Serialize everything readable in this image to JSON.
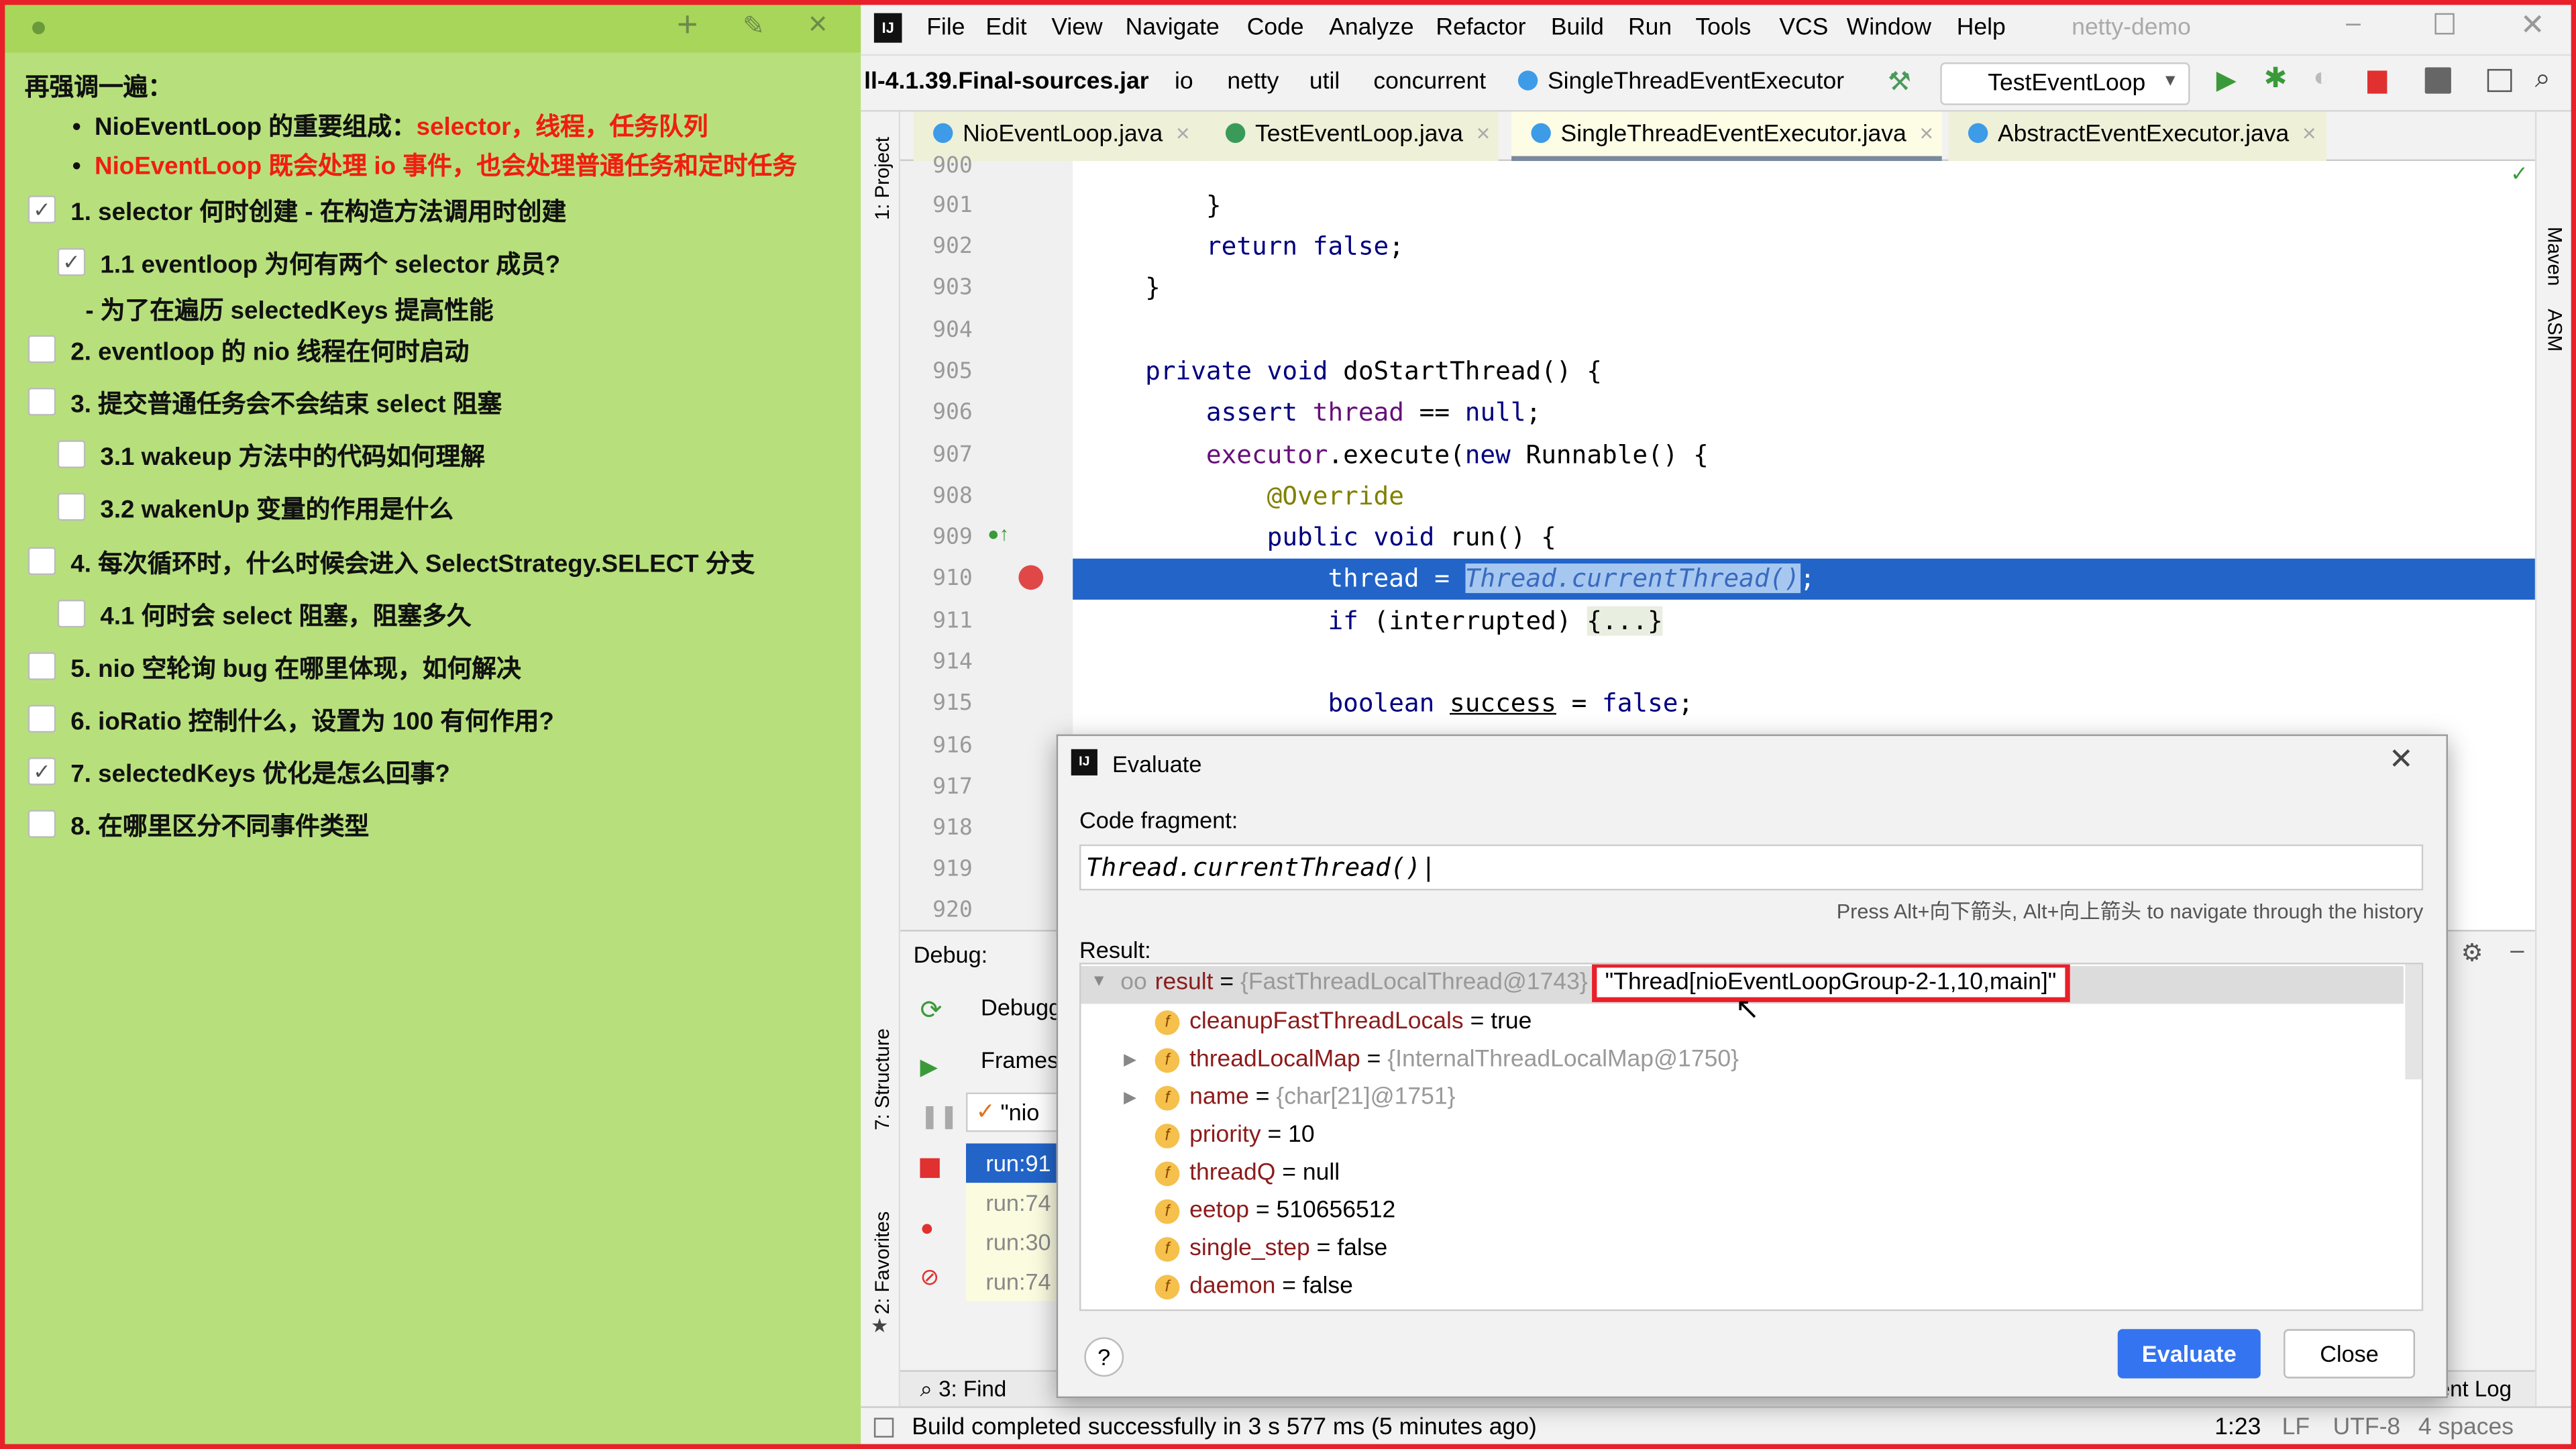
{
  "note": {
    "heading": "再强调一遍：",
    "bullets": [
      {
        "black": "NioEventLoop 的重要组成：",
        "red": "selector，线程，任务队列"
      },
      {
        "black": "",
        "red": "NioEventLoop 既会处理 io 事件，也会处理普通任务和定时任务"
      }
    ],
    "items": [
      {
        "text": "1. selector 何时创建 - 在构造方法调用时创建",
        "checked": true
      },
      {
        "text": "1.1 eventloop 为何有两个 selector 成员?",
        "checked": true
      },
      {
        "text": "- 为了在遍历 selectedKeys 提高性能",
        "checked": null
      },
      {
        "text": "2. eventloop 的 nio 线程在何时启动",
        "checked": false
      },
      {
        "text": "3. 提交普通任务会不会结束 select 阻塞",
        "checked": false
      },
      {
        "text": "3.1 wakeup 方法中的代码如何理解",
        "checked": false
      },
      {
        "text": "3.2 wakenUp 变量的作用是什么",
        "checked": false
      },
      {
        "text": "4. 每次循环时，什么时候会进入 SelectStrategy.SELECT 分支",
        "checked": false
      },
      {
        "text": "4.1 何时会 select 阻塞，阻塞多久",
        "checked": false
      },
      {
        "text": "5. nio 空轮询 bug 在哪里体现，如何解决",
        "checked": false
      },
      {
        "text": "6. ioRatio 控制什么，设置为 100 有何作用?",
        "checked": false
      },
      {
        "text": "7. selectedKeys 优化是怎么回事?",
        "checked": true
      },
      {
        "text": "8. 在哪里区分不同事件类型",
        "checked": false
      }
    ],
    "header_buttons": [
      "+",
      "pin",
      "×"
    ]
  },
  "ide": {
    "menu": [
      "File",
      "Edit",
      "View",
      "Navigate",
      "Code",
      "Analyze",
      "Refactor",
      "Build",
      "Run",
      "Tools",
      "VCS",
      "Window",
      "Help"
    ],
    "project_title": "netty-demo",
    "breadcrumb": [
      "ll-4.1.39.Final-sources.jar",
      "io",
      "netty",
      "util",
      "concurrent",
      "SingleThreadEventExecutor"
    ],
    "run_config": "TestEventLoop",
    "tabs": [
      {
        "label": "NioEventLoop.java",
        "active": false
      },
      {
        "label": "TestEventLoop.java",
        "active": false
      },
      {
        "label": "SingleThreadEventExecutor.java",
        "active": true
      },
      {
        "label": "AbstractEventExecutor.java",
        "active": false
      }
    ],
    "left_tools": [
      "1: Project",
      "7: Structure",
      "2: Favorites"
    ],
    "right_tools": [
      "Maven",
      "ASM"
    ],
    "line_numbers": [
      "900",
      "901",
      "902",
      "903",
      "904",
      "905",
      "906",
      "907",
      "908",
      "909",
      "910",
      "911",
      "914",
      "915",
      "916",
      "917",
      "918",
      "919",
      "920"
    ],
    "code": {
      "l901": "        }",
      "l902_kw": "return false",
      "l903": "    }",
      "l905_kw": "private void ",
      "l905_rest": "doStartThread() {",
      "l906_kw": "assert ",
      "l906_f": "thread",
      "l906_rest": " == ",
      "l906_kw2": "null",
      "l907_f": "executor",
      "l907_rest": ".execute(",
      "l907_kw": "new ",
      "l907_rest2": "Runnable() {",
      "l908": "@Override",
      "l909_kw": "public void ",
      "l909_rest": "run() {",
      "l910_a": "thread = ",
      "l910_b": "Thread.currentThread()",
      "l910_c": ";",
      "l911_kw": "if ",
      "l911_rest": "(interrupted) ",
      "l911_fold": "{...}",
      "l915_kw": "boolean ",
      "l915_var": "success",
      "l915_rest": " = ",
      "l915_kw2": "false",
      "semi": ";"
    },
    "debug": {
      "label": "Debug:",
      "tab": "Debugg",
      "frames": "Frames",
      "thread": "\"nio",
      "frame_items": [
        "run:91",
        "run:74",
        "run:30",
        "run:74"
      ]
    },
    "bottom_tabs": {
      "find": "3: Find",
      "event_log": "Event Log"
    },
    "status": {
      "message": "Build completed successfully in 3 s 577 ms (5 minutes ago)",
      "position": "1:23",
      "line_sep": "LF",
      "encoding": "UTF-8",
      "indent": "4 spaces"
    }
  },
  "evaluate": {
    "title": "Evaluate",
    "fragment_label": "Code fragment:",
    "fragment": "Thread.currentThread()",
    "history_hint": "Press Alt+向下箭头, Alt+向上箭头 to navigate through the history",
    "result_label": "Result:",
    "result": {
      "name": "result",
      "type": "{FastThreadLocalThread@1743}",
      "value": "\"Thread[nioEventLoopGroup-2-1,10,main]\""
    },
    "fields": [
      {
        "name": "cleanupFastThreadLocals",
        "value": "true",
        "gray": false,
        "expandable": false
      },
      {
        "name": "threadLocalMap",
        "value": "{InternalThreadLocalMap@1750}",
        "gray": true,
        "expandable": true
      },
      {
        "name": "name",
        "value": "{char[21]@1751}",
        "gray": true,
        "expandable": true
      },
      {
        "name": "priority",
        "value": "10",
        "gray": false,
        "expandable": false
      },
      {
        "name": "threadQ",
        "value": "null",
        "gray": false,
        "expandable": false
      },
      {
        "name": "eetop",
        "value": "510656512",
        "gray": false,
        "expandable": false
      },
      {
        "name": "single_step",
        "value": "false",
        "gray": false,
        "expandable": false
      },
      {
        "name": "daemon",
        "value": "false",
        "gray": false,
        "expandable": false
      }
    ],
    "evaluate_button": "Evaluate",
    "close_button": "Close",
    "help": "?"
  },
  "colors": {
    "frame": "#e8202a",
    "note_bg": "#b7e07c",
    "highlight": "#2264c8",
    "accent_red": "#f01e10"
  }
}
